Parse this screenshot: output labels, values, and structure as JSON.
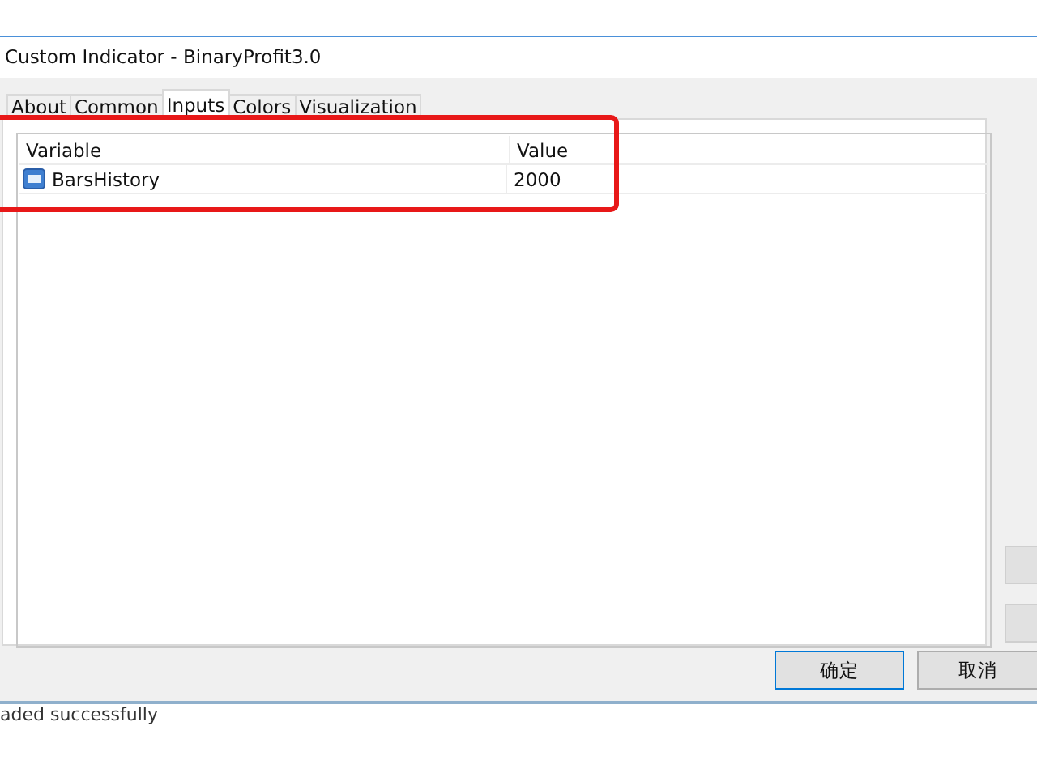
{
  "window": {
    "title": "Custom Indicator - BinaryProfit3.0"
  },
  "tabs": [
    {
      "label": "About",
      "selected": false
    },
    {
      "label": "Common",
      "selected": false
    },
    {
      "label": "Inputs",
      "selected": true
    },
    {
      "label": "Colors",
      "selected": false
    },
    {
      "label": "Visualization",
      "selected": false
    }
  ],
  "table": {
    "columns": [
      "Variable",
      "Value"
    ],
    "rows": [
      {
        "variable": "BarsHistory",
        "value": "2000"
      }
    ]
  },
  "buttons": [
    {
      "label": "确定",
      "default": true
    },
    {
      "label": "取消",
      "default": false
    }
  ],
  "status_bar": "aded successfully"
}
